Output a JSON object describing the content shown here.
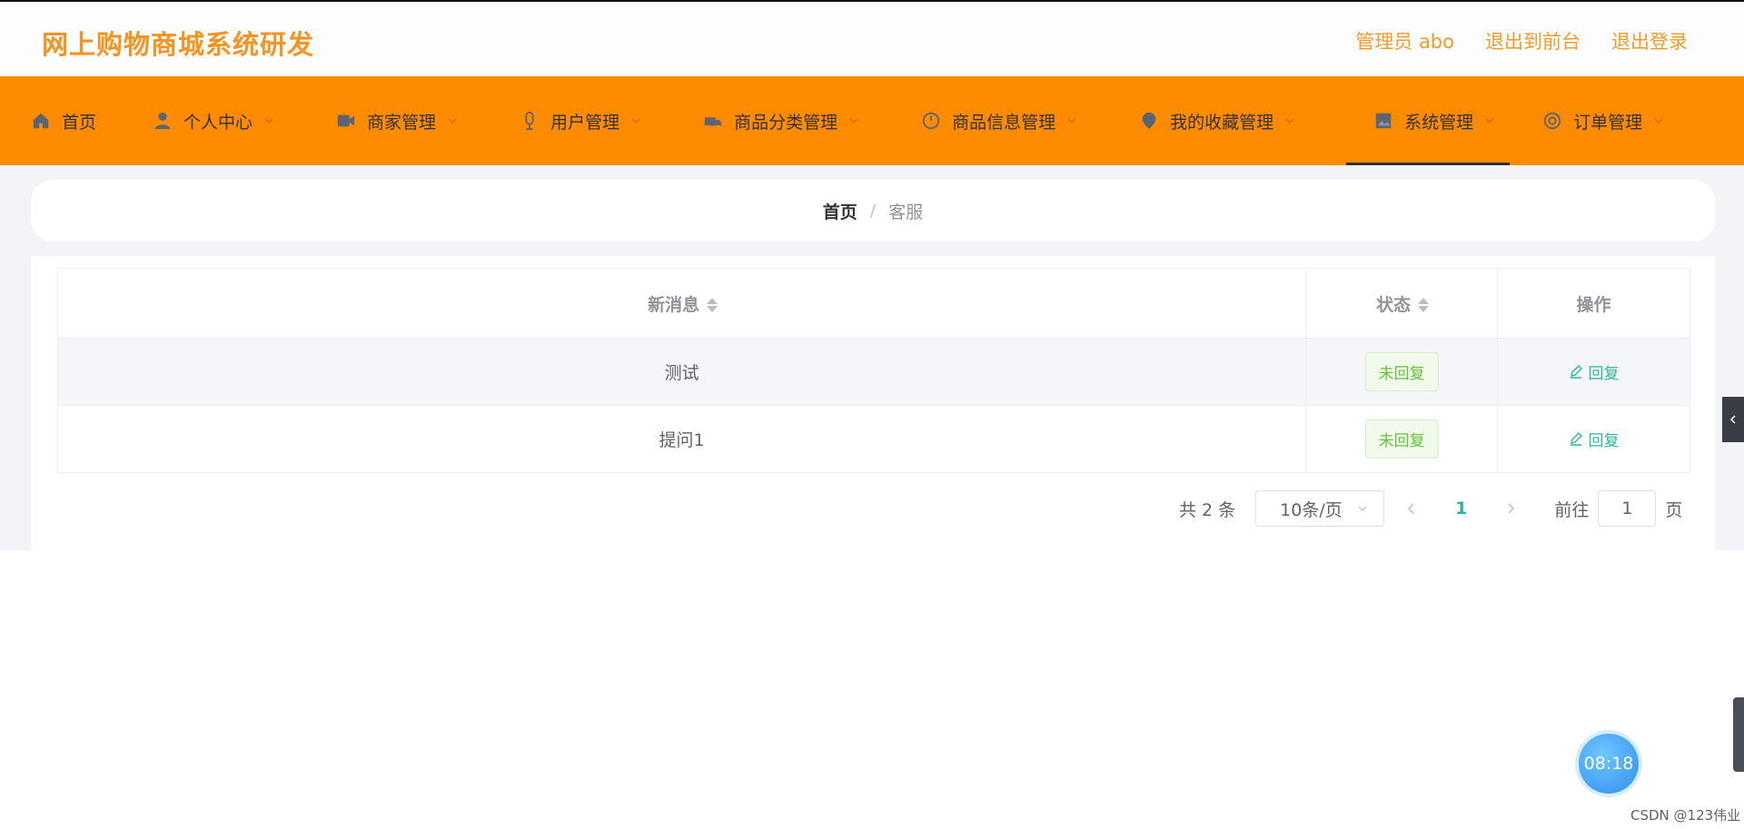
{
  "header": {
    "brand": "网上购物商城系统研发",
    "admin_label": "管理员 abo",
    "back_to_front": "退出到前台",
    "logout": "退出登录"
  },
  "nav": {
    "items": [
      {
        "label": "首页",
        "icon": "home-icon"
      },
      {
        "label": "个人中心",
        "icon": "user-icon"
      },
      {
        "label": "商家管理",
        "icon": "video-icon"
      },
      {
        "label": "用户管理",
        "icon": "microphone-icon"
      },
      {
        "label": "商品分类管理",
        "icon": "truck-icon"
      },
      {
        "label": "商品信息管理",
        "icon": "speedometer-icon"
      },
      {
        "label": "我的收藏管理",
        "icon": "location-icon"
      },
      {
        "label": "系统管理",
        "icon": "picture-icon"
      },
      {
        "label": "订单管理",
        "icon": "target-icon"
      }
    ],
    "active": "系统管理"
  },
  "breadcrumb": {
    "home": "首页",
    "separator": "/",
    "current": "客服"
  },
  "table": {
    "headers": {
      "message": "新消息",
      "status": "状态",
      "actions": "操作"
    },
    "rows": [
      {
        "message": "测试",
        "status": "未回复",
        "action": "回复"
      },
      {
        "message": "提问1",
        "status": "未回复",
        "action": "回复"
      }
    ]
  },
  "pagination": {
    "total": "共 2 条",
    "page_size": "10条/页",
    "current_page": "1",
    "goto_label": "前往",
    "goto_value": "1",
    "page_suffix": "页"
  },
  "overlay": {
    "timer": "08:18",
    "watermark": "CSDN @123伟业"
  },
  "colors": {
    "brand": "#f7931e",
    "nav_bg": "#ff8c00",
    "accent": "#2bb5a0",
    "status_tag": "#67c23a"
  }
}
